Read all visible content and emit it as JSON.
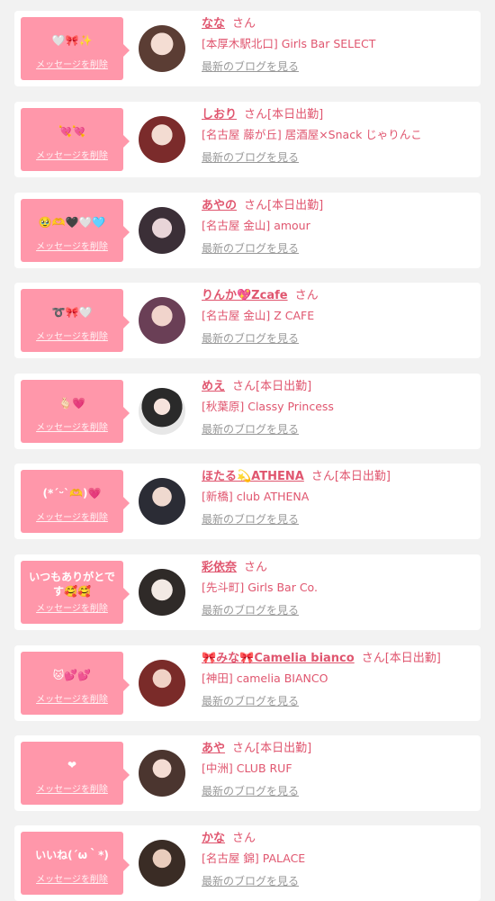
{
  "delete_label": "メッセージを削除",
  "blog_label": "最新のブログを見る",
  "cards": [
    {
      "message": "🤍🎀✨",
      "name": "なな",
      "suffix": "さん",
      "shop": "[本厚木駅北口] Girls Bar SELECT"
    },
    {
      "message": "💘💘",
      "name": "しおり",
      "suffix": "さん[本日出勤]",
      "shop": "[名古屋 藤が丘] 居酒屋×Snack じゃりんこ"
    },
    {
      "message": "🥹🫶🖤🤍🩵",
      "name": "あやの",
      "suffix": "さん[本日出勤]",
      "shop": "[名古屋 金山] amour"
    },
    {
      "message": "➰🎀🤍",
      "name": "りんか💖Zcafe",
      "suffix": "さん",
      "shop": "[名古屋 金山] Z CAFE"
    },
    {
      "message": "🫰🏻💗",
      "name": "めえ",
      "suffix": "さん[本日出勤]",
      "shop": "[秋葉原] Classy Princess"
    },
    {
      "message": "(*´ᵕ`🫶)💗",
      "name": "ほたる💫ATHENA",
      "suffix": "さん[本日出勤]",
      "shop": "[新橋] club ATHENA"
    },
    {
      "message": "いつもありがとです🥰🥰",
      "name": "彩依奈",
      "suffix": "さん",
      "shop": "[先斗町] Girls Bar Co."
    },
    {
      "message": "🐱💕💕",
      "name": "🎀みな🎀Camelia bianco",
      "suffix": "さん[本日出勤]",
      "shop": "[神田] camelia BIANCO"
    },
    {
      "message": "❤︎",
      "name": "あや",
      "suffix": "さん[本日出勤]",
      "shop": "[中洲] CLUB RUF"
    },
    {
      "message": "いいね(´ω｀*)",
      "name": "かな",
      "suffix": "さん",
      "shop": "[名古屋 錦] PALACE"
    }
  ]
}
